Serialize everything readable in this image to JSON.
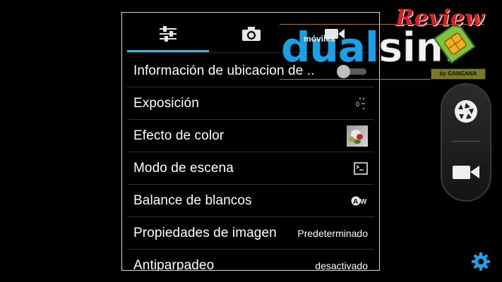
{
  "tabs": [
    {
      "id": "settings",
      "icon": "sliders-icon",
      "active": true
    },
    {
      "id": "photo",
      "icon": "camera-icon",
      "active": false
    },
    {
      "id": "video",
      "icon": "video-camera-icon",
      "active": false
    }
  ],
  "settings": [
    {
      "label": "Información de ubicacion de ..",
      "control": "toggle",
      "toggle_on": false
    },
    {
      "label": "Exposición",
      "control": "icon",
      "icon": "exposure-icon",
      "value": "0"
    },
    {
      "label": "Efecto de color",
      "control": "icon",
      "icon": "color-effect-thumbnail"
    },
    {
      "label": "Modo de escena",
      "control": "icon",
      "icon": "scene-mode-icon"
    },
    {
      "label": "Balance de blancos",
      "control": "icon",
      "icon": "white-balance-auto-icon",
      "value": "AW"
    },
    {
      "label": "Propiedades de imagen",
      "control": "text",
      "value": "Predeterminado"
    },
    {
      "label": "Antiparpadeo",
      "control": "text",
      "value": "desactivado"
    }
  ],
  "shutter": {
    "photo_icon": "shutter-icon",
    "video_icon": "video-record-icon"
  },
  "gear_icon": "gear-icon",
  "watermark": {
    "word_1": "dual",
    "word_2": "sim",
    "small": "móviles",
    "review": "Review",
    "tag": "by GANGANA"
  },
  "colors": {
    "accent": "#33b5e5",
    "gear": "#1ea1e8",
    "watermark_blue": "#1aa0e6",
    "watermark_red": "#d81f1f"
  }
}
